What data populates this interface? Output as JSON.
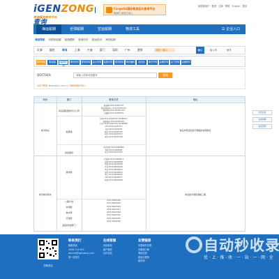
{
  "header": {
    "brand_a": "iGEN",
    "brand_b": "ZONG",
    "brand_c": "|查询",
    "tagline": "物流服务综合平台",
    "banner_title": "CargoGo国际物流运价查询平台",
    "banner_sub": "用我们,省钱又省心",
    "toplinks": [
      "我是新用户",
      "登录",
      "注册",
      "帮助",
      "English",
      "更多"
    ]
  },
  "nav": {
    "items": [
      "海运船期",
      "全球船期",
      "空运船期",
      "物流工具"
    ],
    "login": "企业入口"
  },
  "breadcrumb": {
    "home": "海运导航",
    "items": [
      "可视化船期",
      "船舶跟踪",
      "查询历史",
      "航运资讯",
      "海关船期"
    ]
  },
  "citybar": {
    "cities": [
      "天津",
      "烟台",
      "青岛",
      "上海",
      "宁波",
      "厦门",
      "深圳",
      "广州",
      "更多"
    ],
    "selected": "青岛",
    "search_hint": "请选一港口",
    "button": "确认",
    "others": [
      "船公司",
      "更多"
    ]
  },
  "filterbar": {
    "tags": [
      "港口查询",
      "集装箱",
      "船期查询",
      "海关报关",
      "提单查询",
      "运价查询",
      "船舶动态",
      "堆场查询",
      "海关编码",
      "危险品",
      "海关代码",
      "运输查询",
      "运力查询",
      "运输资讯"
    ]
  },
  "search": {
    "label": "QQCT码头",
    "placeholder": "请输入提单号或箱号",
    "button": "查询",
    "sub_a": "QQCT码头",
    "sub_b": "www.qqct.com.cn",
    "sub_c": "7868/8887501"
  },
  "table": {
    "headers": [
      "码头",
      "部门",
      "联系方式",
      "地址"
    ],
    "group1": "前湾码头",
    "group1_depts": [
      "青岛港集团前湾分公司",
      "集装箱",
      "综合服务"
    ],
    "group1_lines_a": [
      "集装箱:0532-82987587",
      "散货调度中心:0532-82987331",
      "国际中转:0532-82987100",
      "冷藏箱:0532-82987652"
    ],
    "group1_lines_b": [
      "场地:0532-82987587 82988877",
      "船期调度:0532-82987887",
      "综合:0532-82987555 82988888",
      "CFS:0532-82987677",
      "海关:0532-8299000",
      "报关:0532-82987587",
      "码头:0532-82987677",
      "港务:0532-82987400"
    ],
    "group1_lines_c": [
      "前湾港区:0532-8688888",
      "物流:0532-8288998",
      "办公:0532-82987587"
    ],
    "group1_addr": "青岛市黄岛区前湾港路综合服务区",
    "group2": "前湾联合码头",
    "group2_depts": [
      "操作部",
      "二期计划",
      "市场部",
      "技术部",
      "行政部",
      "集团/综合部门"
    ],
    "group2_lines_a": [
      "计划部:0532-89608877",
      "调度:0532-89608888",
      "场站:0532-89608858",
      "外代:0532-89608800",
      "单证:0532-89608811",
      "海关:0532-89608812",
      "中心:0532-89608905",
      "CFS:0532-89608877",
      "检验:0532-89608866"
    ],
    "group2_lines_b": [
      "0532-86697864",
      "0532-86697806",
      "0532-86697809",
      "0532-86697837",
      "0532-86697864",
      "0532-86697850",
      "0532-86697855",
      "0532-82862898"
    ],
    "group2_addr": "青岛前湾港区港前三路"
  },
  "footer": {
    "qr_caption": "扫码关注",
    "col1_title": "联系我们",
    "col1_lines": [
      "客服热线",
      "4006-714-916",
      "service@igenzong.com",
      "周一至周五"
    ],
    "col2_title": "在线客服",
    "col2_lines": [
      "在线咨询",
      "客户服务",
      "合作洽谈"
    ],
    "col3_title": "友情链接",
    "col3_lines": [
      "中国海关总署",
      "中国港口网",
      "海运在线",
      "航运交易所",
      "船讯网"
    ]
  },
  "watermark": {
    "big": "自动秒收录",
    "small": "优 · 上 · 推 · 收 · 一 · 站 · 一 · 网 · 全"
  },
  "side_tabs": [
    "意见反馈",
    "在线客服",
    "返回顶部"
  ],
  "colors": {
    "primary": "#1f6fc1",
    "accent": "#f59a23",
    "header_bg": "#eaf1f9"
  }
}
